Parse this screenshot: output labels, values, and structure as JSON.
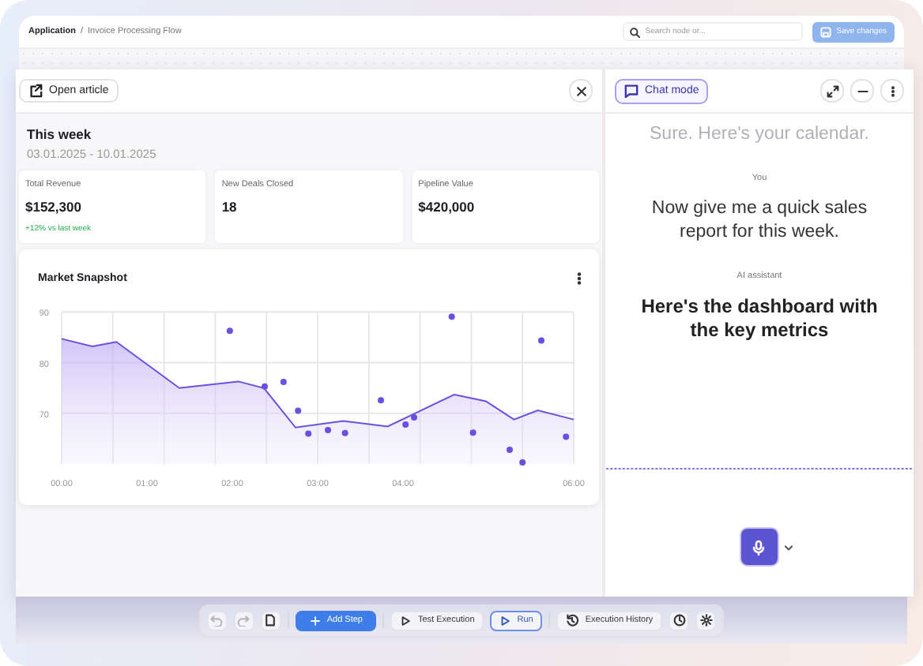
{
  "header": {
    "breadcrumb": [
      {
        "label": "Application",
        "current": false
      },
      {
        "label": "Invoice Processing Flow",
        "current": true
      }
    ],
    "separator": "/",
    "search": {
      "placeholder": "Search node or..."
    },
    "save_button": {
      "label": "Save changes",
      "disabled": true
    }
  },
  "article_panel": {
    "open_button": "Open article",
    "period": {
      "title": "This week",
      "range": "03.01.2025 - 10.01.2025"
    },
    "stats": [
      {
        "label": "Total Revenue",
        "value": "$152,300",
        "change": "+12% vs last week"
      },
      {
        "label": "New Deals Closed",
        "value": "18"
      },
      {
        "label": "Pipeline Value",
        "value": "$420,000"
      }
    ],
    "chart_card": {
      "title": "Market Snapshot",
      "chart_data": {
        "type": "area",
        "grid": true,
        "xlim": [
          0,
          6
        ],
        "ylim": [
          60,
          90
        ],
        "yticks": [
          70,
          80,
          90
        ],
        "xticks": [
          {
            "value": 0,
            "label": "00:00"
          },
          {
            "value": 1,
            "label": "01:00"
          },
          {
            "value": 2,
            "label": "02:00"
          },
          {
            "value": 3,
            "label": "03:00"
          },
          {
            "value": 4,
            "label": "04:00"
          },
          {
            "value": 6,
            "label": "06:00"
          }
        ],
        "x": [
          0,
          0.36,
          0.64,
          1.38,
          2.07,
          2.37,
          2.74,
          3.3,
          3.82,
          4.6,
          4.97,
          5.3,
          5.58,
          6
        ],
        "series": [
          {
            "color": "#6a4fe0",
            "values": [
              84.7,
              83.2,
              84.1,
              75.0,
              76.3,
              75.0,
              67.2,
              68.5,
              67.4,
              73.7,
              72.4,
              68.8,
              70.6,
              68.8
            ]
          }
        ]
      }
    }
  },
  "chat_panel": {
    "mode_button": {
      "label": "Chat mode",
      "selected": true
    },
    "messages": [
      {
        "text": "Sure. Here's your calendar.",
        "faded": true
      },
      {
        "sender": "You",
        "text": "Now give me a quick sales report for this week.",
        "faded": false
      },
      {
        "sender": "AI assistant",
        "text": "Here's the dashboard with the key metrics",
        "faded": false
      }
    ]
  },
  "toolbar": {
    "groups": [
      [
        {
          "kind": "undo",
          "disabled": true
        },
        {
          "kind": "redo",
          "disabled": true
        },
        {
          "kind": "page",
          "disabled": false
        }
      ],
      [
        {
          "kind": "primary",
          "label": "Add Step"
        }
      ],
      [
        {
          "kind": "play",
          "label": "Test Execution",
          "selected": false
        },
        {
          "kind": "play",
          "label": "Run",
          "selected": true
        }
      ],
      [
        {
          "kind": "history",
          "label": "Execution History"
        },
        {
          "kind": "clock",
          "disabled": false
        },
        {
          "kind": "gear",
          "disabled": false
        }
      ]
    ]
  }
}
